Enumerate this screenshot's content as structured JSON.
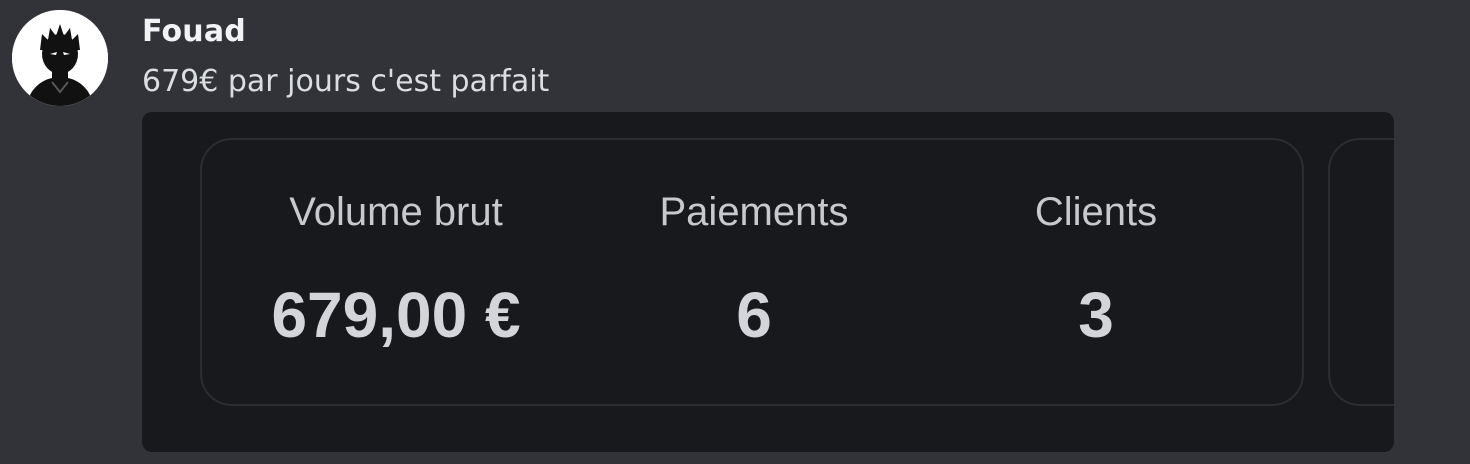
{
  "message": {
    "author": "Fouad",
    "text": "679€ par jours c'est parfait",
    "avatar_icon": "anime-character-avatar"
  },
  "stats_card": {
    "stats": [
      {
        "label": "Volume brut",
        "value": "679,00 €"
      },
      {
        "label": "Paiements",
        "value": "6"
      },
      {
        "label": "Clients",
        "value": "3"
      }
    ]
  },
  "colors": {
    "background": "#313338",
    "attachment_bg": "#18191d",
    "card_border": "#2c2d33",
    "username": "#f2f3f5",
    "text": "#dbdee1"
  }
}
